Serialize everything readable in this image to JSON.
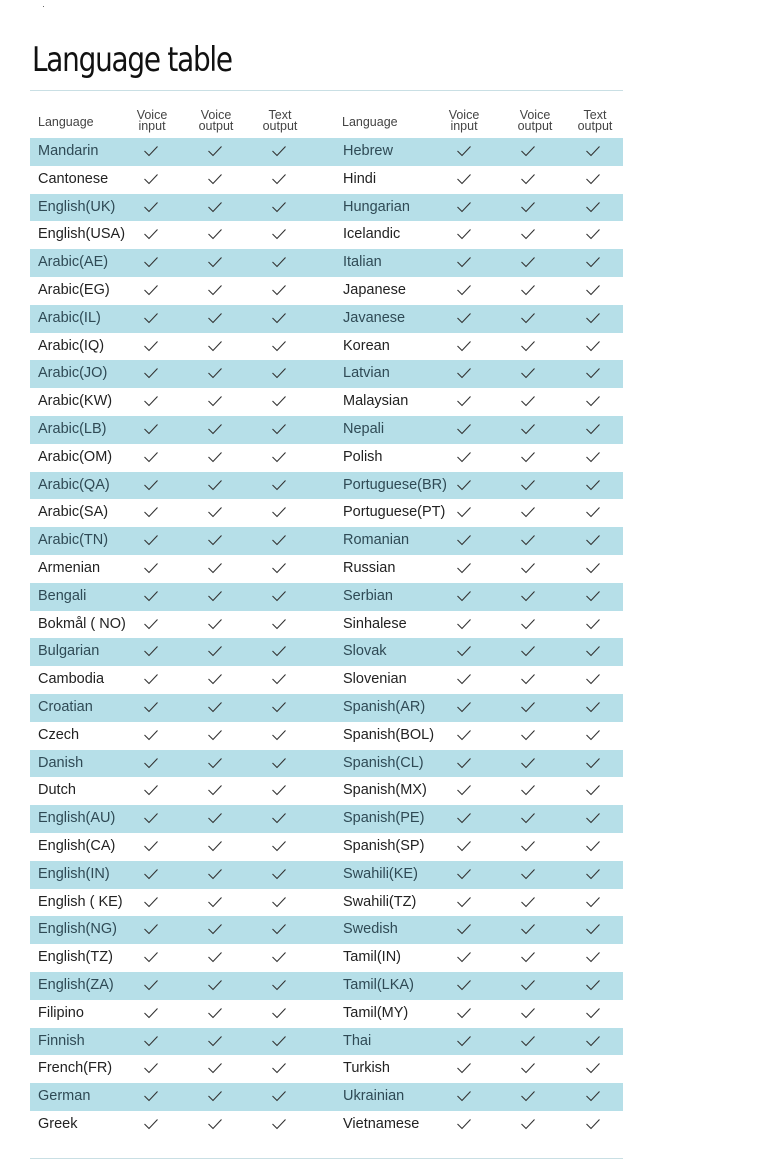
{
  "title": "Language table",
  "headers": {
    "language": "Language",
    "voice_input": "Voice\ninput",
    "voice_output": "Voice\noutput",
    "text_output": "Text\noutput"
  },
  "check_icon": "checkmark-icon",
  "colors": {
    "shade": "#b6dfe8",
    "rule": "#c9dfe4"
  },
  "left_column": [
    {
      "language": "Mandarin",
      "voice_input": true,
      "voice_output": true,
      "text_output": true
    },
    {
      "language": "Cantonese",
      "voice_input": true,
      "voice_output": true,
      "text_output": true
    },
    {
      "language": "English(UK)",
      "voice_input": true,
      "voice_output": true,
      "text_output": true
    },
    {
      "language": "English(USA)",
      "voice_input": true,
      "voice_output": true,
      "text_output": true
    },
    {
      "language": "Arabic(AE)",
      "voice_input": true,
      "voice_output": true,
      "text_output": true
    },
    {
      "language": "Arabic(EG)",
      "voice_input": true,
      "voice_output": true,
      "text_output": true
    },
    {
      "language": "Arabic(IL)",
      "voice_input": true,
      "voice_output": true,
      "text_output": true
    },
    {
      "language": "Arabic(IQ)",
      "voice_input": true,
      "voice_output": true,
      "text_output": true
    },
    {
      "language": "Arabic(JO)",
      "voice_input": true,
      "voice_output": true,
      "text_output": true
    },
    {
      "language": "Arabic(KW)",
      "voice_input": true,
      "voice_output": true,
      "text_output": true
    },
    {
      "language": "Arabic(LB)",
      "voice_input": true,
      "voice_output": true,
      "text_output": true
    },
    {
      "language": "Arabic(OM)",
      "voice_input": true,
      "voice_output": true,
      "text_output": true
    },
    {
      "language": "Arabic(QA)",
      "voice_input": true,
      "voice_output": true,
      "text_output": true
    },
    {
      "language": "Arabic(SA)",
      "voice_input": true,
      "voice_output": true,
      "text_output": true
    },
    {
      "language": "Arabic(TN)",
      "voice_input": true,
      "voice_output": true,
      "text_output": true
    },
    {
      "language": "Armenian",
      "voice_input": true,
      "voice_output": true,
      "text_output": true
    },
    {
      "language": "Bengali",
      "voice_input": true,
      "voice_output": true,
      "text_output": true
    },
    {
      "language": "Bokmål ( NO)",
      "voice_input": true,
      "voice_output": true,
      "text_output": true
    },
    {
      "language": "Bulgarian",
      "voice_input": true,
      "voice_output": true,
      "text_output": true
    },
    {
      "language": "Cambodia",
      "voice_input": true,
      "voice_output": true,
      "text_output": true
    },
    {
      "language": "Croatian",
      "voice_input": true,
      "voice_output": true,
      "text_output": true
    },
    {
      "language": "Czech",
      "voice_input": true,
      "voice_output": true,
      "text_output": true
    },
    {
      "language": "Danish",
      "voice_input": true,
      "voice_output": true,
      "text_output": true
    },
    {
      "language": "Dutch",
      "voice_input": true,
      "voice_output": true,
      "text_output": true
    },
    {
      "language": "English(AU)",
      "voice_input": true,
      "voice_output": true,
      "text_output": true
    },
    {
      "language": "English(CA)",
      "voice_input": true,
      "voice_output": true,
      "text_output": true
    },
    {
      "language": "English(IN)",
      "voice_input": true,
      "voice_output": true,
      "text_output": true
    },
    {
      "language": "English ( KE)",
      "voice_input": true,
      "voice_output": true,
      "text_output": true
    },
    {
      "language": "English(NG)",
      "voice_input": true,
      "voice_output": true,
      "text_output": true
    },
    {
      "language": "English(TZ)",
      "voice_input": true,
      "voice_output": true,
      "text_output": true
    },
    {
      "language": "English(ZA)",
      "voice_input": true,
      "voice_output": true,
      "text_output": true
    },
    {
      "language": "Filipino",
      "voice_input": true,
      "voice_output": true,
      "text_output": true
    },
    {
      "language": "Finnish",
      "voice_input": true,
      "voice_output": true,
      "text_output": true
    },
    {
      "language": "French(FR)",
      "voice_input": true,
      "voice_output": true,
      "text_output": true
    },
    {
      "language": "German",
      "voice_input": true,
      "voice_output": true,
      "text_output": true
    },
    {
      "language": "Greek",
      "voice_input": true,
      "voice_output": true,
      "text_output": true
    }
  ],
  "right_column": [
    {
      "language": "Hebrew",
      "voice_input": true,
      "voice_output": true,
      "text_output": true
    },
    {
      "language": "Hindi",
      "voice_input": true,
      "voice_output": true,
      "text_output": true
    },
    {
      "language": "Hungarian",
      "voice_input": true,
      "voice_output": true,
      "text_output": true
    },
    {
      "language": "Icelandic",
      "voice_input": true,
      "voice_output": true,
      "text_output": true
    },
    {
      "language": "Italian",
      "voice_input": true,
      "voice_output": true,
      "text_output": true
    },
    {
      "language": "Japanese",
      "voice_input": true,
      "voice_output": true,
      "text_output": true
    },
    {
      "language": "Javanese",
      "voice_input": true,
      "voice_output": true,
      "text_output": true
    },
    {
      "language": "Korean",
      "voice_input": true,
      "voice_output": true,
      "text_output": true
    },
    {
      "language": "Latvian",
      "voice_input": true,
      "voice_output": true,
      "text_output": true
    },
    {
      "language": "Malaysian",
      "voice_input": true,
      "voice_output": true,
      "text_output": true
    },
    {
      "language": "Nepali",
      "voice_input": true,
      "voice_output": true,
      "text_output": true
    },
    {
      "language": "Polish",
      "voice_input": true,
      "voice_output": true,
      "text_output": true
    },
    {
      "language": "Portuguese(BR)",
      "voice_input": true,
      "voice_output": true,
      "text_output": true
    },
    {
      "language": "Portuguese(PT)",
      "voice_input": true,
      "voice_output": true,
      "text_output": true
    },
    {
      "language": "Romanian",
      "voice_input": true,
      "voice_output": true,
      "text_output": true
    },
    {
      "language": "Russian",
      "voice_input": true,
      "voice_output": true,
      "text_output": true
    },
    {
      "language": "Serbian",
      "voice_input": true,
      "voice_output": true,
      "text_output": true
    },
    {
      "language": "Sinhalese",
      "voice_input": true,
      "voice_output": true,
      "text_output": true
    },
    {
      "language": "Slovak",
      "voice_input": true,
      "voice_output": true,
      "text_output": true
    },
    {
      "language": "Slovenian",
      "voice_input": true,
      "voice_output": true,
      "text_output": true
    },
    {
      "language": "Spanish(AR)",
      "voice_input": true,
      "voice_output": true,
      "text_output": true
    },
    {
      "language": "Spanish(BOL)",
      "voice_input": true,
      "voice_output": true,
      "text_output": true
    },
    {
      "language": "Spanish(CL)",
      "voice_input": true,
      "voice_output": true,
      "text_output": true
    },
    {
      "language": "Spanish(MX)",
      "voice_input": true,
      "voice_output": true,
      "text_output": true
    },
    {
      "language": "Spanish(PE)",
      "voice_input": true,
      "voice_output": true,
      "text_output": true
    },
    {
      "language": "Spanish(SP)",
      "voice_input": true,
      "voice_output": true,
      "text_output": true
    },
    {
      "language": "Swahili(KE)",
      "voice_input": true,
      "voice_output": true,
      "text_output": true
    },
    {
      "language": "Swahili(TZ)",
      "voice_input": true,
      "voice_output": true,
      "text_output": true
    },
    {
      "language": "Swedish",
      "voice_input": true,
      "voice_output": true,
      "text_output": true
    },
    {
      "language": "Tamil(IN)",
      "voice_input": true,
      "voice_output": true,
      "text_output": true
    },
    {
      "language": "Tamil(LKA)",
      "voice_input": true,
      "voice_output": true,
      "text_output": true
    },
    {
      "language": "Tamil(MY)",
      "voice_input": true,
      "voice_output": true,
      "text_output": true
    },
    {
      "language": "Thai",
      "voice_input": true,
      "voice_output": true,
      "text_output": true
    },
    {
      "language": "Turkish",
      "voice_input": true,
      "voice_output": true,
      "text_output": true
    },
    {
      "language": "Ukrainian",
      "voice_input": true,
      "voice_output": true,
      "text_output": true
    },
    {
      "language": "Vietnamese",
      "voice_input": true,
      "voice_output": true,
      "text_output": true
    }
  ]
}
